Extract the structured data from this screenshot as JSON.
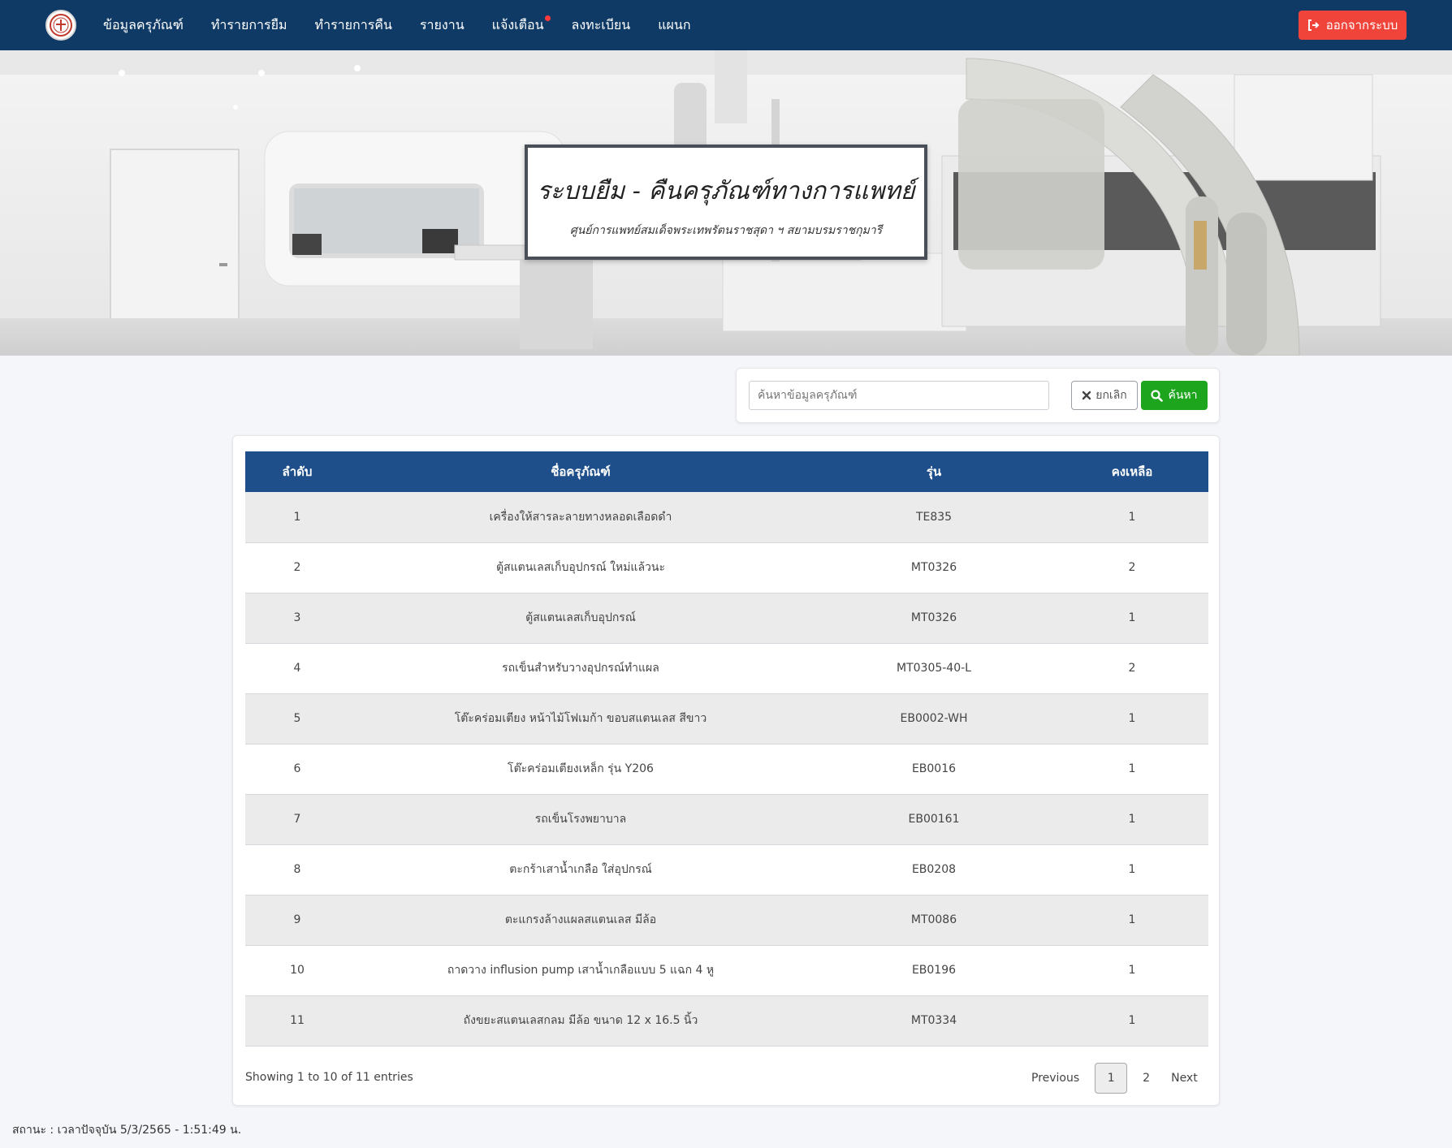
{
  "nav": {
    "items": [
      "ข้อมูลครุภัณฑ์",
      "ทำรายการยืม",
      "ทำรายการคืน",
      "รายงาน",
      "แจ้งเตือน",
      "ลงทะเบียน",
      "แผนก"
    ],
    "logout_label": "ออกจากระบบ",
    "notification_dot_color": "#ff3b3b"
  },
  "hero": {
    "title": "ระบบยืม - คืนครุภัณฑ์ทางการแพทย์",
    "subtitle": "ศูนย์การแพทย์สมเด็จพระเทพรัตนราชสุดา ฯ สยามบรมราชกุมารี"
  },
  "search": {
    "placeholder": "ค้นหาข้อมูลครุภัณฑ์",
    "cancel_label": "ยกเลิก",
    "search_label": "ค้นหา"
  },
  "table": {
    "headers": [
      "ลำดับ",
      "ชื่อครุภัณฑ์",
      "รุ่น",
      "คงเหลือ"
    ],
    "rows": [
      [
        "1",
        "เครื่องให้สารละลายทางหลอดเลือดดำ",
        "TE835",
        "1"
      ],
      [
        "2",
        "ตู้สแตนเลสเก็บอุปกรณ์ ใหม่แล้วนะ",
        "MT0326",
        "2"
      ],
      [
        "3",
        "ตู้สแตนเลสเก็บอุปกรณ์",
        "MT0326",
        "1"
      ],
      [
        "4",
        "รถเข็นสำหรับวางอุปกรณ์ทำแผล",
        "MT0305-40-L",
        "2"
      ],
      [
        "5",
        "โต๊ะคร่อมเตียง หน้าไม้โฟเมก้า ขอบสแตนเลส สีขาว",
        "EB0002-WH",
        "1"
      ],
      [
        "6",
        "โต๊ะคร่อมเตียงเหล็ก รุ่น Y206",
        "EB0016",
        "1"
      ],
      [
        "7",
        "รถเข็นโรงพยาบาล",
        "EB00161",
        "1"
      ],
      [
        "8",
        "ตะกร้าเสาน้ำเกลือ ใส่อุปกรณ์",
        "EB0208",
        "1"
      ],
      [
        "9",
        "ตะแกรงล้างแผลสแตนเลส มีล้อ",
        "MT0086",
        "1"
      ],
      [
        "10",
        "ถาดวาง influsion pump เสาน้ำเกลือแบบ 5 แฉก 4 หู",
        "EB0196",
        "1"
      ],
      [
        "11",
        "ถังขยะสแตนเลสกลม มีล้อ ขนาด 12 x 16.5 นิ้ว",
        "MT0334",
        "1"
      ]
    ],
    "info": "Showing 1 to 10 of 11 entries",
    "pagination": {
      "previous": "Previous",
      "pages": [
        "1",
        "2"
      ],
      "active": "1",
      "next": "Next"
    }
  },
  "status": "สถานะ : เวลาปัจจุบัน 5/3/2565 - 1:51:49 น.",
  "colors": {
    "navbar": "#0f3a66",
    "table_header": "#1e4f8a",
    "logout": "#f0443a",
    "search_button": "#1ea51e"
  }
}
